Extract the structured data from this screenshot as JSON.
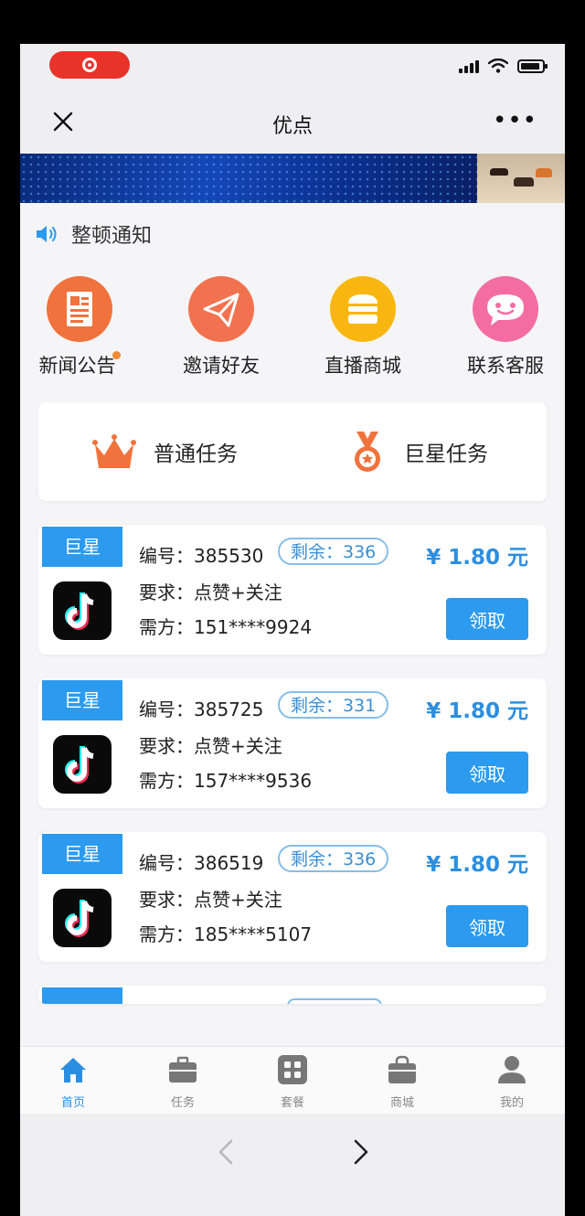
{
  "nav": {
    "title": "优点"
  },
  "notice": {
    "text": "整顿通知"
  },
  "menu": [
    {
      "label": "新闻公告",
      "icon": "news-icon",
      "color": "#f0723c"
    },
    {
      "label": "邀请好友",
      "icon": "paper-plane-icon",
      "color": "#f2724f"
    },
    {
      "label": "直播商城",
      "icon": "store-icon",
      "color": "#f8b60f"
    },
    {
      "label": "联系客服",
      "icon": "chat-icon",
      "color": "#f36da3"
    }
  ],
  "task_tabs": [
    {
      "label": "普通任务",
      "icon": "crown-icon"
    },
    {
      "label": "巨星任务",
      "icon": "medal-icon"
    }
  ],
  "tasks": [
    {
      "tag": "巨星",
      "id_label": "编号：",
      "id": "385530",
      "remain": "剩余：336",
      "req_label": "要求：",
      "req": "点赞+关注",
      "party_label": "需方：",
      "party": "151****9924",
      "price": "¥ 1.80 元",
      "button": "领取"
    },
    {
      "tag": "巨星",
      "id_label": "编号：",
      "id": "385725",
      "remain": "剩余：331",
      "req_label": "要求：",
      "req": "点赞+关注",
      "party_label": "需方：",
      "party": "157****9536",
      "price": "¥ 1.80 元",
      "button": "领取"
    },
    {
      "tag": "巨星",
      "id_label": "编号：",
      "id": "386519",
      "remain": "剩余：336",
      "req_label": "要求：",
      "req": "点赞+关注",
      "party_label": "需方：",
      "party": "185****5107",
      "price": "¥ 1.80 元",
      "button": "领取"
    }
  ],
  "tabbar": [
    {
      "label": "首页",
      "icon": "home-icon",
      "active": true
    },
    {
      "label": "任务",
      "icon": "briefcase-icon",
      "active": false
    },
    {
      "label": "套餐",
      "icon": "grid-icon",
      "active": false
    },
    {
      "label": "商城",
      "icon": "shopping-bag-icon",
      "active": false
    },
    {
      "label": "我的",
      "icon": "user-icon",
      "active": false
    }
  ],
  "colors": {
    "accent": "#2c9aee",
    "price": "#2c8ee0",
    "recording": "#e8332b"
  }
}
